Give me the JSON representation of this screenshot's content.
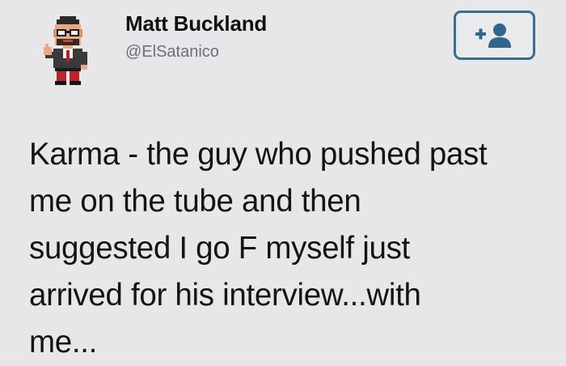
{
  "user": {
    "display_name": "Matt Buckland",
    "handle": "@ElSatanico",
    "avatar_icon": "pixel-art-avatar-icon"
  },
  "follow_button": {
    "icon": "add-user-icon",
    "border_color": "#3b6c8f"
  },
  "tweet": {
    "lines": [
      "Karma - the guy who pushed past",
      "me on the tube and then",
      "suggested I go F myself just",
      "arrived for his interview...with",
      "me..."
    ]
  }
}
